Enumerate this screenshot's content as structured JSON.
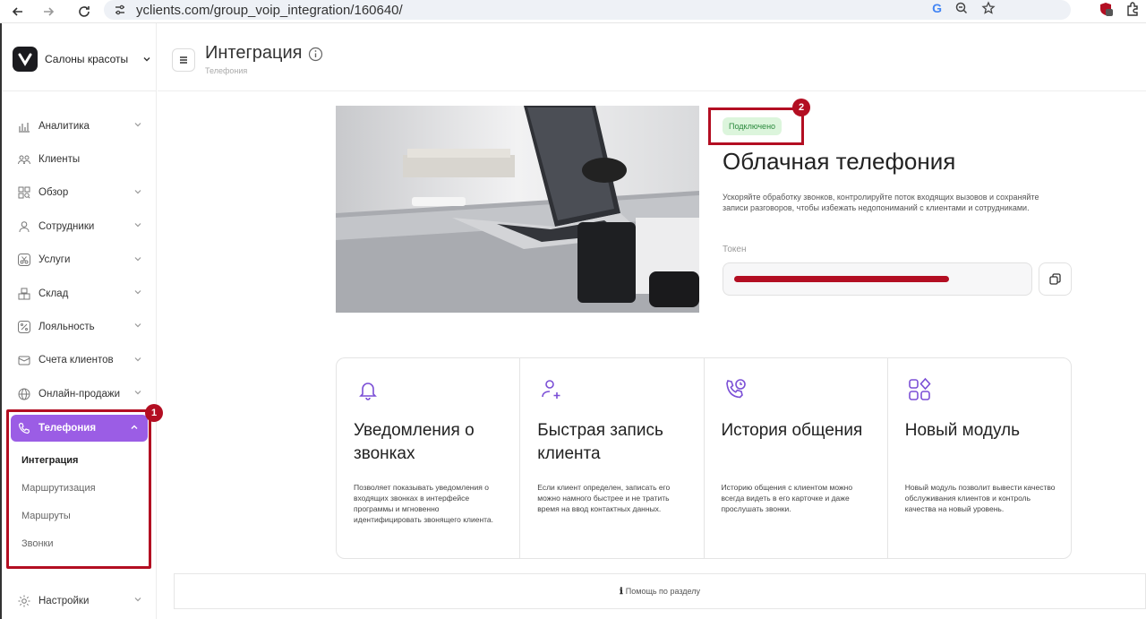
{
  "browser": {
    "url": "yclients.com/group_voip_integration/160640/"
  },
  "sidebar": {
    "brand_name": "Салоны красоты",
    "items": [
      {
        "label": "Аналитика",
        "icon": "chart-icon",
        "has_chevron": true
      },
      {
        "label": "Клиенты",
        "icon": "users-icon",
        "has_chevron": false
      },
      {
        "label": "Обзор",
        "icon": "grid-search-icon",
        "has_chevron": true
      },
      {
        "label": "Сотрудники",
        "icon": "user-icon",
        "has_chevron": true
      },
      {
        "label": "Услуги",
        "icon": "scissors-icon",
        "has_chevron": true
      },
      {
        "label": "Склад",
        "icon": "boxes-icon",
        "has_chevron": true
      },
      {
        "label": "Лояльность",
        "icon": "percent-icon",
        "has_chevron": true
      },
      {
        "label": "Счета клиентов",
        "icon": "wallet-icon",
        "has_chevron": true
      },
      {
        "label": "Онлайн-продажи",
        "icon": "globe-icon",
        "has_chevron": true
      }
    ],
    "active_item": {
      "label": "Телефония",
      "icon": "phone-icon"
    },
    "subitems": [
      {
        "label": "Интеграция",
        "current": true
      },
      {
        "label": "Маршрутизация",
        "current": false
      },
      {
        "label": "Маршруты",
        "current": false
      },
      {
        "label": "Звонки",
        "current": false
      }
    ],
    "settings": {
      "label": "Настройки",
      "icon": "gear-icon"
    }
  },
  "header": {
    "title": "Интеграция",
    "breadcrumb": "Телефония"
  },
  "hero": {
    "status": "Подключено",
    "title": "Облачная телефония",
    "description": "Ускоряйте обработку звонков, контролируйте поток входящих вызовов и сохраняйте записи разговоров, чтобы избежать недопониманий с клиентами и сотрудниками.",
    "token_label": "Токен"
  },
  "features": [
    {
      "icon": "bell-icon",
      "title": "Уведомления о звонках",
      "description": "Позволяет показывать уведомления о входящих звонках в интерфейсе программы и мгновенно идентифицировать звонящего клиента."
    },
    {
      "icon": "user-plus-icon",
      "title": "Быстрая запись клиента",
      "description": "Если клиент определен, записать его можно намного быстрее и не тратить время на ввод контактных данных."
    },
    {
      "icon": "phone-history-icon",
      "title": "История общения",
      "description": "Историю общения с клиентом можно всегда видеть в его карточке и даже прослушать звонки."
    },
    {
      "icon": "modules-icon",
      "title": "Новый модуль",
      "description": "Новый модуль позволит вывести качество обслуживания клиентов и контроль качества на новый уровень."
    }
  ],
  "help": {
    "label": "Помощь по разделу"
  },
  "annotations": {
    "badge_1": "1",
    "badge_2": "2"
  },
  "colors": {
    "accent": "#9b5de5",
    "annotation_red": "#b30e22",
    "status_green_bg": "#dcf5dc",
    "status_green_text": "#2b8a3e"
  }
}
